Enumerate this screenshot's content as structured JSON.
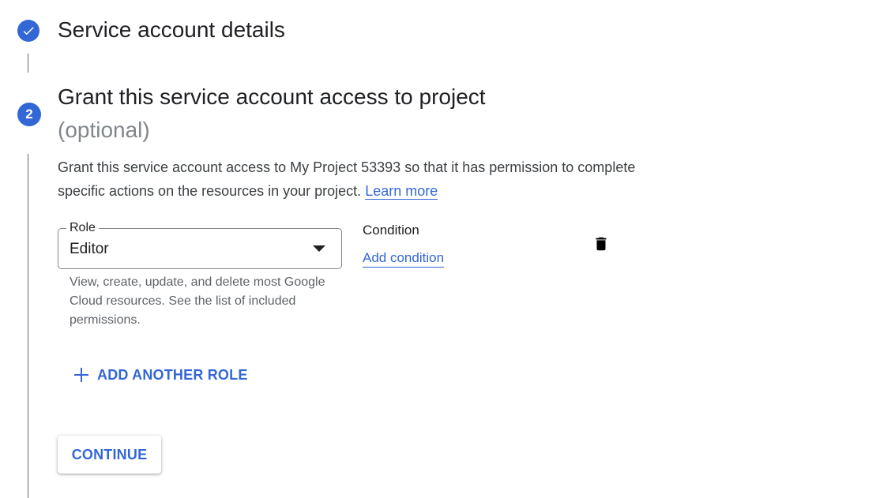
{
  "steps": [
    {
      "title": "Service account details",
      "status": "completed",
      "icon": "check-icon"
    },
    {
      "number": "2",
      "title": "Grant this service account access to project",
      "optional_label": "(optional)"
    }
  ],
  "description": {
    "text": "Grant this service account access to My Project 53393 so that it has permission to complete specific actions on the resources in your project.",
    "learn_more": "Learn more"
  },
  "role": {
    "label": "Role",
    "value": "Editor",
    "help_text": "View, create, update, and delete most Google Cloud resources. See the list of included permissions."
  },
  "condition": {
    "title": "Condition",
    "add_link": "Add condition"
  },
  "actions": {
    "add_role": "ADD ANOTHER ROLE",
    "continue": "CONTINUE"
  },
  "colors": {
    "accent": "#3367d6",
    "text": "#202124",
    "muted": "#5f6368",
    "optional": "#80868b"
  }
}
